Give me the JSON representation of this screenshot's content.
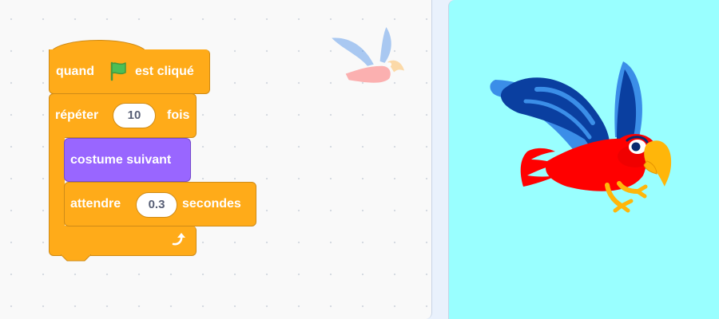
{
  "script": {
    "hat": {
      "label_before": "quand",
      "icon": "green-flag-icon",
      "label_after": "est cliqué"
    },
    "repeat": {
      "label_before": "répéter",
      "count": "10",
      "label_after": "fois",
      "loop_icon": "loop-arrow-icon"
    },
    "costume": {
      "label": "costume suivant"
    },
    "wait": {
      "label_before": "attendre",
      "seconds": "0.3",
      "label_after": "secondes"
    }
  },
  "sprite": {
    "name": "parrot",
    "icon": "parrot-sprite"
  },
  "colors": {
    "control": "#ffab19",
    "looks": "#9966ff",
    "stage_background": "#99ffff",
    "flag": "#4cbf56"
  }
}
